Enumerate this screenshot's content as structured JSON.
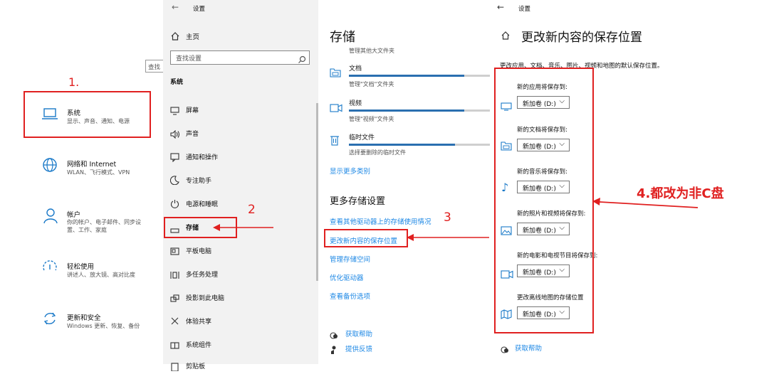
{
  "panel1": {
    "search_partial": "查找",
    "items": [
      {
        "title": "系统",
        "sub": "显示、声音、通知、电源"
      },
      {
        "title": "网络和 Internet",
        "sub": "WLAN、飞行模式、VPN"
      },
      {
        "title": "帐户",
        "sub": "你的帐户、电子邮件、同步设置、工作、家庭"
      },
      {
        "title": "轻松使用",
        "sub": "讲述人、放大镜、高对比度"
      },
      {
        "title": "更新和安全",
        "sub": "Windows 更新、恢复、备份"
      }
    ]
  },
  "panel2": {
    "title": "设置",
    "home": "主页",
    "search_placeholder": "查找设置",
    "section": "系统",
    "items": [
      "屏幕",
      "声音",
      "通知和操作",
      "专注助手",
      "电源和睡眠",
      "存储",
      "平板电脑",
      "多任务处理",
      "投影到此电脑",
      "体验共享",
      "系统组件",
      "剪贴板"
    ]
  },
  "panel3": {
    "title": "存储",
    "sub_first": "管理其他大文件夹",
    "items": [
      {
        "title": "文档",
        "sub": "管理\"文档\"文件夹",
        "fill": 0.82
      },
      {
        "title": "视频",
        "sub": "管理\"视频\"文件夹",
        "fill": 0.82
      },
      {
        "title": "临时文件",
        "sub": "选择要删除的临时文件",
        "fill": 0.75
      }
    ],
    "show_more": "显示更多类别",
    "more_title": "更多存储设置",
    "links": [
      "查看其他驱动器上的存储使用情况",
      "更改新内容的保存位置",
      "管理存储空间",
      "优化驱动器",
      "查看备份选项"
    ],
    "help": "获取帮助",
    "feedback": "提供反馈"
  },
  "panel4": {
    "top_title": "设置",
    "title": "更改新内容的保存位置",
    "desc": "更改应用、文档、音乐、图片、视频和地图的默认保存位置。",
    "rows": [
      {
        "label": "新的应用将保存到:",
        "value": "新加卷 (D:)"
      },
      {
        "label": "新的文档将保存到:",
        "value": "新加卷 (D:)"
      },
      {
        "label": "新的音乐将保存到:",
        "value": "新加卷 (D:)"
      },
      {
        "label": "新的照片和视频将保存到:",
        "value": "新加卷 (D:)"
      },
      {
        "label": "新的电影和电视节目将保存到:",
        "value": "新加卷 (D:)"
      },
      {
        "label": "更改离线地图的存储位置",
        "value": "新加卷 (D:)"
      }
    ],
    "help": "获取帮助"
  },
  "annotations": {
    "step1": "1.",
    "step2": "2",
    "step3": "3",
    "step4": "4.都改为非C盘"
  },
  "colors": {
    "accent": "#1e88e5",
    "annotation": "#e02020",
    "sidebar_bg": "#f2f2f2"
  }
}
